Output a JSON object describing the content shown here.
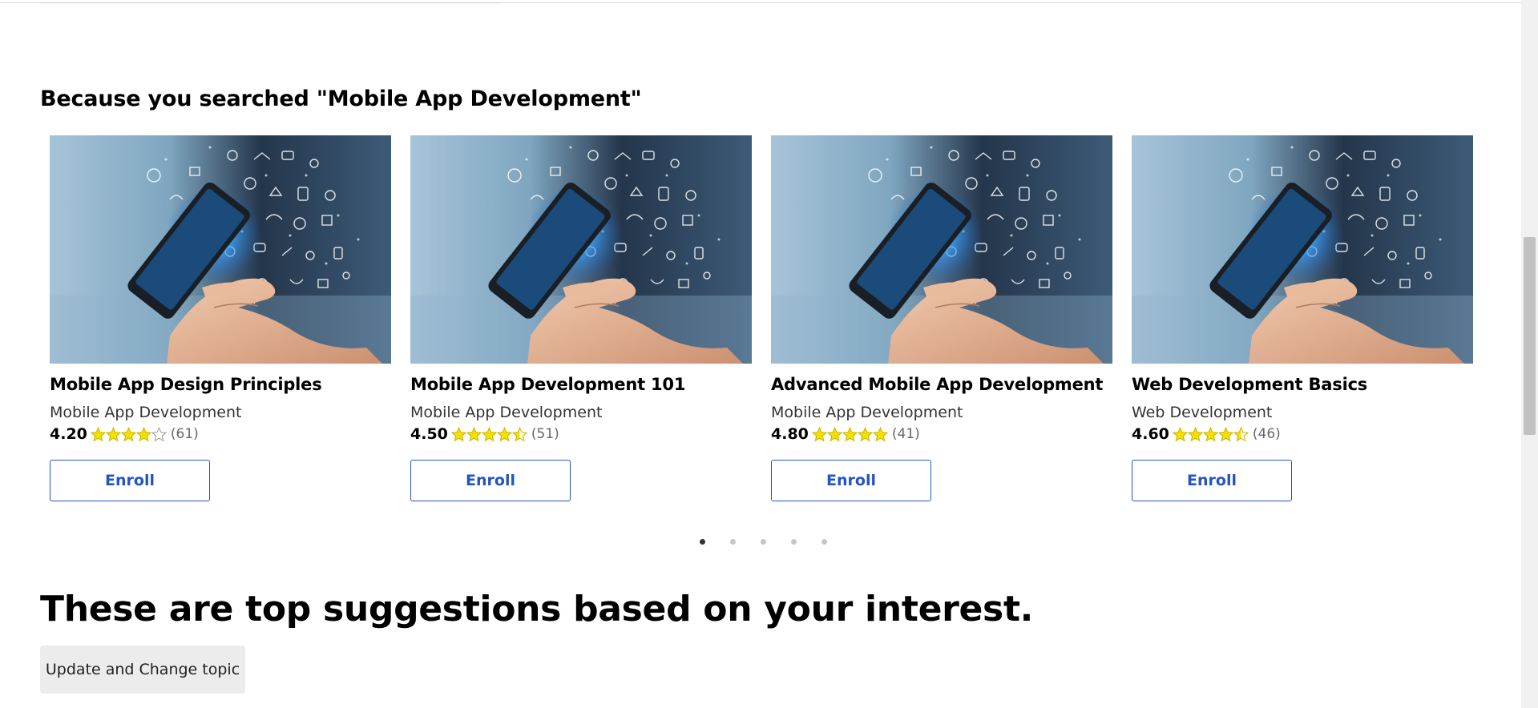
{
  "section": {
    "title": "Because you searched \"Mobile App Development\""
  },
  "courses": [
    {
      "title": "Mobile App Design Principles",
      "category": "Mobile App Development",
      "rating": "4.20",
      "rating_value": 4.2,
      "count": "(61)",
      "button": "Enroll"
    },
    {
      "title": "Mobile App Development 101",
      "category": "Mobile App Development",
      "rating": "4.50",
      "rating_value": 4.5,
      "count": "(51)",
      "button": "Enroll"
    },
    {
      "title": "Advanced Mobile App Development",
      "category": "Mobile App Development",
      "rating": "4.80",
      "rating_value": 4.8,
      "count": "(41)",
      "button": "Enroll"
    },
    {
      "title": "Web Development Basics",
      "category": "Web Development",
      "rating": "4.60",
      "rating_value": 4.6,
      "count": "(46)",
      "button": "Enroll"
    }
  ],
  "carousel": {
    "page_count": 5,
    "active_page": 1
  },
  "suggestions": {
    "heading": "These are top suggestions based on your interest.",
    "button": "Update and Change topic"
  },
  "colors": {
    "accent": "#2453c4",
    "star_fill": "#f7e000",
    "star_outline": "#9a9a9a"
  }
}
